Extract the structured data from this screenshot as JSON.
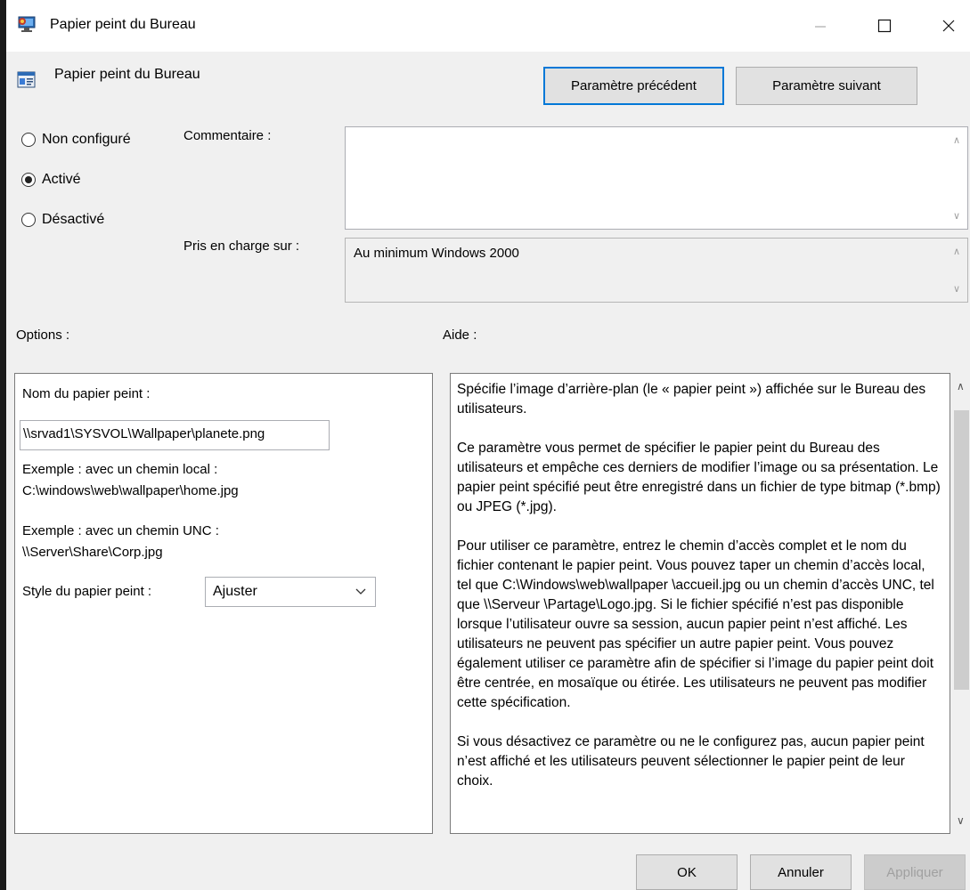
{
  "window": {
    "title": "Papier peint du Bureau",
    "icon": "desktop-settings-icon",
    "controls": [
      "minimize-icon",
      "maximize-icon",
      "close-icon"
    ]
  },
  "header": {
    "setting_name": "Papier peint du Bureau",
    "icon": "policy-setting-icon",
    "prev_button": "Paramètre précédent",
    "next_button": "Paramètre suivant"
  },
  "state": {
    "options": [
      "Non configuré",
      "Activé",
      "Désactivé"
    ],
    "selected": "Activé"
  },
  "comment": {
    "label": "Commentaire :",
    "value": ""
  },
  "supported": {
    "label": "Pris en charge sur :",
    "value": "Au minimum Windows 2000"
  },
  "options": {
    "label": "Options :",
    "wallpaper_name_label": "Nom du papier peint :",
    "wallpaper_name_value": "\\\\srvad1\\SYSVOL\\Wallpaper\\planete.png",
    "example_local_label": "Exemple : avec un chemin local :",
    "example_local_path": "C:\\windows\\web\\wallpaper\\home.jpg",
    "example_unc_label": "Exemple : avec un chemin UNC :",
    "example_unc_path": "\\\\Server\\Share\\Corp.jpg",
    "style_label": "Style du papier peint :",
    "style_value": "Ajuster"
  },
  "help": {
    "label": "Aide :",
    "paragraphs": [
      "Spécifie l’image d’arrière-plan (le « papier peint ») affichée sur le Bureau des utilisateurs.",
      "Ce paramètre vous permet de spécifier le papier peint du Bureau des utilisateurs et empêche ces derniers de modifier l’image ou sa présentation. Le papier peint spécifié peut être enregistré dans un fichier de type bitmap (*.bmp) ou JPEG (*.jpg).",
      "Pour utiliser ce paramètre, entrez le chemin d’accès complet et le nom du fichier contenant le papier peint. Vous pouvez taper un chemin d’accès local, tel que C:\\Windows\\web\\wallpaper \\accueil.jpg ou un chemin d’accès UNC, tel que \\\\Serveur \\Partage\\Logo.jpg. Si le fichier spécifié n’est pas disponible lorsque l’utilisateur ouvre sa session, aucun papier peint n’est affiché. Les utilisateurs ne peuvent pas spécifier un autre papier peint. Vous pouvez également utiliser ce paramètre afin de spécifier si l’image du papier peint doit être centrée, en mosaïque ou étirée. Les utilisateurs ne peuvent pas modifier cette spécification.",
      "Si vous désactivez ce paramètre ou ne le configurez pas, aucun papier peint n’est affiché et les utilisateurs peuvent sélectionner le papier peint de leur choix."
    ]
  },
  "footer": {
    "ok": "OK",
    "cancel": "Annuler",
    "apply": "Appliquer"
  },
  "colors": {
    "accent": "#0078d7",
    "background": "#f0f0f0"
  }
}
